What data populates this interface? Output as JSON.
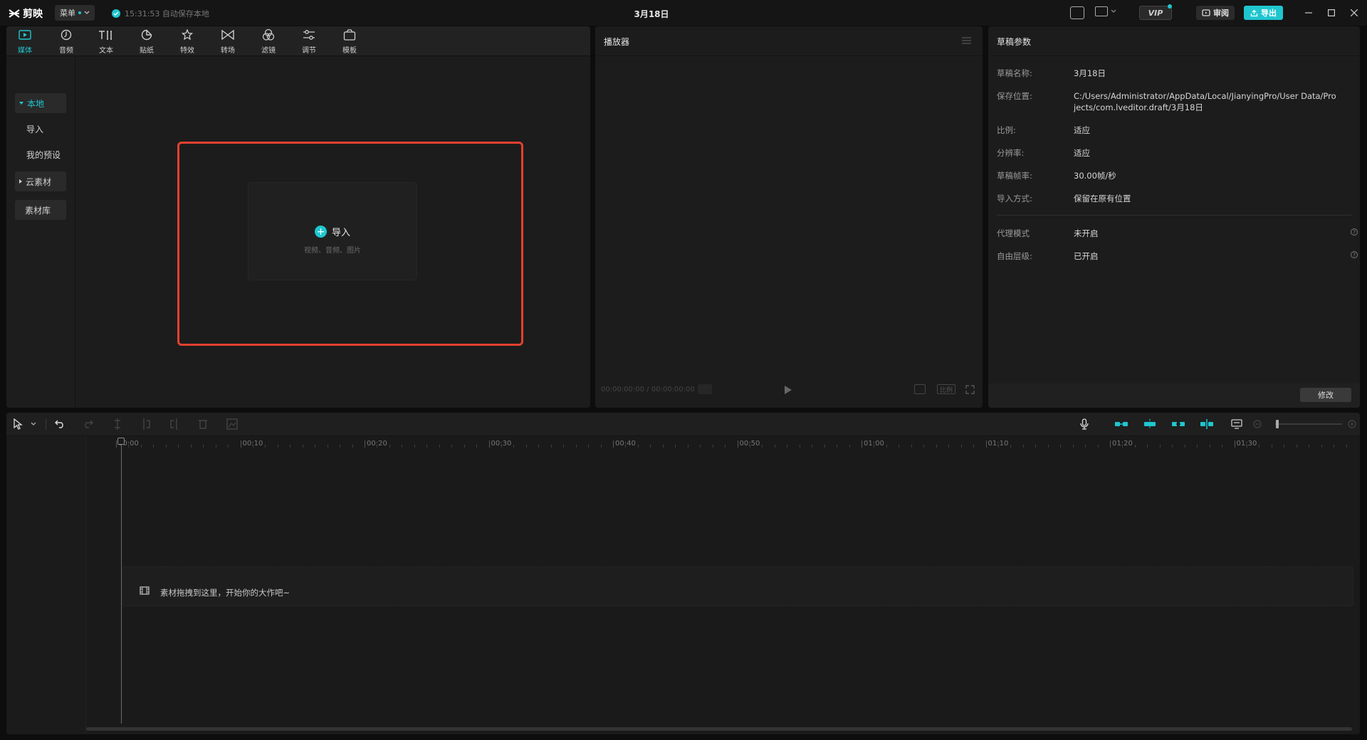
{
  "app": {
    "logo_text": "剪映",
    "menu_label": "菜单",
    "autosave_text": "15:31:53 自动保存本地",
    "project_title": "3月18日",
    "vip_label": "VIP",
    "review_label": "审阅",
    "export_label": "导出"
  },
  "toolbar": {
    "tabs": [
      {
        "label": "媒体",
        "icon": "media-icon"
      },
      {
        "label": "音频",
        "icon": "audio-icon"
      },
      {
        "label": "文本",
        "icon": "text-icon"
      },
      {
        "label": "贴纸",
        "icon": "sticker-icon"
      },
      {
        "label": "特效",
        "icon": "effects-icon"
      },
      {
        "label": "转场",
        "icon": "transition-icon"
      },
      {
        "label": "滤镜",
        "icon": "filter-icon"
      },
      {
        "label": "调节",
        "icon": "adjust-icon"
      },
      {
        "label": "模板",
        "icon": "template-icon"
      }
    ],
    "active_tab": "媒体"
  },
  "sidebar": {
    "items": [
      {
        "label": "本地"
      },
      {
        "label": "导入"
      },
      {
        "label": "我的预设"
      },
      {
        "label": "云素材"
      },
      {
        "label": "素材库"
      }
    ]
  },
  "media": {
    "import_label": "导入",
    "import_hint": "视频、音频、图片"
  },
  "player": {
    "title": "播放器",
    "timecode": "00:00:00:00 / 00:00:00:00",
    "ratio_label": "比例"
  },
  "params": {
    "title": "草稿参数",
    "rows": [
      {
        "key": "草稿名称:",
        "value": "3月18日"
      },
      {
        "key": "保存位置:",
        "value": "C:/Users/Administrator/AppData/Local/JianyingPro/User Data/Projects/com.lveditor.draft/3月18日"
      },
      {
        "key": "比例:",
        "value": "适应"
      },
      {
        "key": "分辨率:",
        "value": "适应"
      },
      {
        "key": "草稿帧率:",
        "value": "30.00帧/秒"
      },
      {
        "key": "导入方式:",
        "value": "保留在原有位置"
      },
      {
        "key": "代理模式",
        "value": "未开启"
      },
      {
        "key": "自由层级:",
        "value": "已开启"
      }
    ],
    "modify_label": "修改"
  },
  "timeline": {
    "ticks": [
      "00:00",
      "00:10",
      "00:20",
      "00:30",
      "00:40",
      "00:50",
      "01:00",
      "01:10",
      "01:20",
      "01:30"
    ],
    "drop_hint": "素材拖拽到这里，开始你的大作吧~"
  },
  "colors": {
    "accent": "#1fc6cf",
    "highlight": "#e3402f",
    "panel_bg": "#1c1c1c"
  }
}
